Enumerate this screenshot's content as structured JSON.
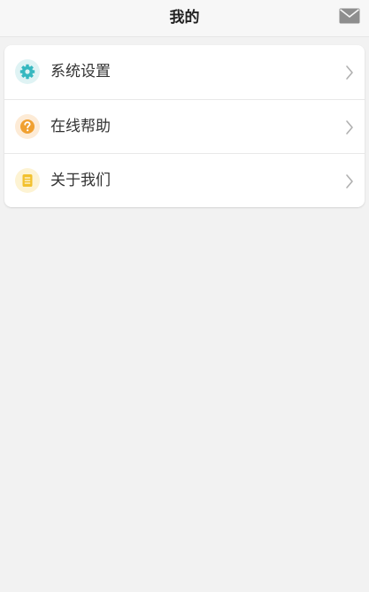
{
  "header": {
    "title": "我的",
    "mail_icon": "mail-icon"
  },
  "menu": {
    "items": [
      {
        "label": "系统设置",
        "icon": "gear-icon",
        "icon_bg": "#dff3f4",
        "icon_color": "#36b8c0"
      },
      {
        "label": "在线帮助",
        "icon": "question-icon",
        "icon_bg": "#fdebd6",
        "icon_color": "#f0a030"
      },
      {
        "label": "关于我们",
        "icon": "document-icon",
        "icon_bg": "#fdf3d3",
        "icon_color": "#f2c12e"
      }
    ]
  },
  "colors": {
    "background": "#f2f2f2",
    "card": "#ffffff"
  }
}
